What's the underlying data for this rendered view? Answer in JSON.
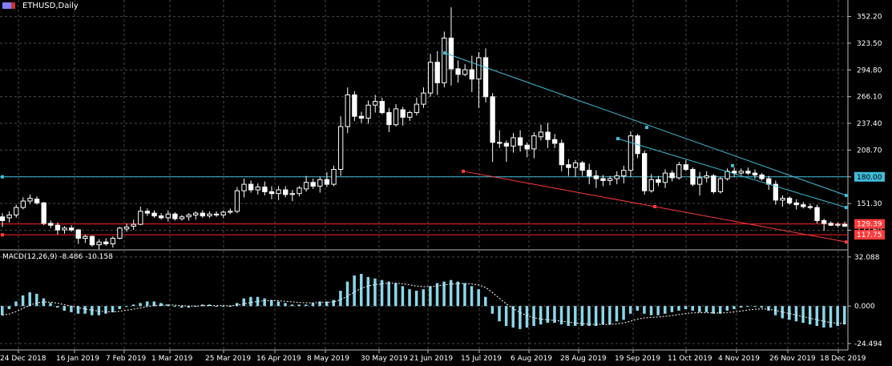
{
  "header": {
    "symbol": "ETHUSD,Daily"
  },
  "macd_header": {
    "name": "MACD(12,26,9)",
    "main": "-8.486",
    "signal": "-10.158"
  },
  "colors": {
    "background": "#000000",
    "grid": "#4a4a4a",
    "candle": "#ffffff",
    "cyan_line": "#3fbcd8",
    "red_line": "#ff3b3b",
    "macd_hist": "#8ad6e8",
    "macd_signal": "#ffffff"
  },
  "chart_data": [
    {
      "type": "candlestick",
      "title": "ETHUSD,Daily",
      "y_ticks": [
        "352.20",
        "323.50",
        "294.80",
        "266.10",
        "237.40",
        "208.70",
        "180.00",
        "151.30",
        "122.60"
      ],
      "ylim": [
        102.4,
        361.3
      ],
      "x_ticks": [
        "24 Dec 2018",
        "16 Jan 2019",
        "7 Feb 2019",
        "1 Mar 2019",
        "25 Mar 2019",
        "16 Apr 2019",
        "8 May 2019",
        "30 May 2019",
        "21 Jun 2019",
        "15 Jul 2019",
        "6 Aug 2019",
        "28 Aug 2019",
        "19 Sep 2019",
        "11 Oct 2019",
        "4 Nov 2019",
        "26 Nov 2019",
        "18 Dec 2019"
      ],
      "grid": true,
      "price_levels": [
        {
          "label": "180.00",
          "value": 180.0,
          "color": "#3fbcd8"
        },
        {
          "label": "129.39",
          "value": 129.39,
          "color": "#ff2020"
        },
        {
          "label": "117.75",
          "value": 117.75,
          "color": "#ff2020"
        }
      ],
      "series": [
        {
          "values": [
            [
              137,
              126,
              141,
              133
            ],
            [
              136,
              131,
              143,
              139
            ],
            [
              139,
              136,
              150,
              147
            ],
            [
              147,
              145,
              158,
              154
            ],
            [
              154,
              151,
              161,
              157
            ],
            [
              156,
              150,
              159,
              152
            ],
            [
              152,
              128,
              153,
              130
            ],
            [
              130,
              125,
              133,
              128
            ],
            [
              128,
              118,
              131,
              123
            ],
            [
              123,
              119,
              127,
              125
            ],
            [
              125,
              121,
              128,
              123
            ],
            [
              123,
              108,
              124,
              114
            ],
            [
              114,
              109,
              118,
              116
            ],
            [
              116,
              105,
              117,
              107
            ],
            [
              107,
              102,
              113,
              110
            ],
            [
              110,
              106,
              114,
              108
            ],
            [
              108,
              104,
              116,
              114
            ],
            [
              114,
              113,
              126,
              125
            ],
            [
              124,
              121,
              130,
              126
            ],
            [
              127,
              123,
              134,
              129
            ],
            [
              129,
              128,
              148,
              143
            ],
            [
              143,
              138,
              146,
              141
            ],
            [
              141,
              136,
              144,
              138
            ],
            [
              138,
              134,
              141,
              136
            ],
            [
              136,
              132,
              144,
              140
            ],
            [
              140,
              133,
              142,
              135
            ],
            [
              135,
              133,
              139,
              137
            ],
            [
              137,
              133,
              141,
              139
            ],
            [
              139,
              134,
              143,
              141
            ],
            [
              141,
              136,
              144,
              138
            ],
            [
              138,
              136,
              143,
              140
            ],
            [
              140,
              137,
              143,
              139
            ],
            [
              139,
              136,
              144,
              142
            ],
            [
              142,
              140,
              146,
              143
            ],
            [
              143,
              141,
              169,
              165
            ],
            [
              165,
              158,
              178,
              172
            ],
            [
              172,
              163,
              176,
              166
            ],
            [
              166,
              161,
              173,
              169
            ],
            [
              169,
              160,
              175,
              164
            ],
            [
              164,
              156,
              170,
              162
            ],
            [
              162,
              155,
              170,
              166
            ],
            [
              166,
              158,
              170,
              161
            ],
            [
              161,
              154,
              166,
              162
            ],
            [
              162,
              159,
              170,
              168
            ],
            [
              167,
              164,
              181,
              174
            ],
            [
              174,
              167,
              178,
              170
            ],
            [
              170,
              163,
              180,
              177
            ],
            [
              177,
              169,
              185,
              172
            ],
            [
              172,
              170,
              192,
              188
            ],
            [
              188,
              181,
              245,
              234
            ],
            [
              234,
              227,
              276,
              268
            ],
            [
              268,
              240,
              272,
              245
            ],
            [
              245,
              238,
              250,
              243
            ],
            [
              243,
              237,
              262,
              257
            ],
            [
              257,
              249,
              268,
              261
            ],
            [
              261,
              247,
              265,
              249
            ],
            [
              249,
              228,
              254,
              236
            ],
            [
              236,
              234,
              258,
              253
            ],
            [
              252,
              235,
              255,
              244
            ],
            [
              244,
              240,
              251,
              249
            ],
            [
              249,
              246,
              265,
              258
            ],
            [
              258,
              254,
              276,
              270
            ],
            [
              270,
              266,
              312,
              303
            ],
            [
              303,
              268,
              315,
              281
            ],
            [
              281,
              276,
              336,
              329
            ],
            [
              329,
              278,
              362,
              296
            ],
            [
              296,
              281,
              305,
              290
            ],
            [
              290,
              288,
              301,
              295
            ],
            [
              295,
              271,
              310,
              285
            ],
            [
              285,
              254,
              314,
              308
            ],
            [
              308,
              260,
              318,
              266
            ],
            [
              266,
              196,
              270,
              217
            ],
            [
              217,
              211,
              230,
              216
            ],
            [
              216,
              196,
              219,
              213
            ],
            [
              213,
              206,
              227,
              222
            ],
            [
              222,
              207,
              230,
              214
            ],
            [
              214,
              201,
              217,
              210
            ],
            [
              210,
              200,
              228,
              224
            ],
            [
              223,
              219,
              236,
              228
            ],
            [
              228,
              211,
              238,
              220
            ],
            [
              220,
              211,
              226,
              216
            ],
            [
              216,
              186,
              220,
              193
            ],
            [
              193,
              181,
              199,
              190
            ],
            [
              190,
              180,
              198,
              195
            ],
            [
              195,
              181,
              197,
              187
            ],
            [
              187,
              172,
              194,
              181
            ],
            [
              181,
              168,
              187,
              178
            ],
            [
              178,
              170,
              182,
              176
            ],
            [
              176,
              171,
              181,
              178
            ],
            [
              178,
              172,
              186,
              181
            ],
            [
              181,
              173,
              192,
              187
            ],
            [
              187,
              180,
              229,
              224
            ],
            [
              224,
              200,
              226,
              205
            ],
            [
              205,
              161,
              208,
              165
            ],
            [
              165,
              163,
              183,
              177
            ],
            [
              177,
              170,
              181,
              174
            ],
            [
              174,
              168,
              188,
              184
            ],
            [
              184,
              175,
              187,
              179
            ],
            [
              179,
              177,
              196,
              193
            ],
            [
              193,
              186,
              198,
              188
            ],
            [
              188,
              170,
              190,
              172
            ],
            [
              172,
              160,
              185,
              179
            ],
            [
              179,
              174,
              186,
              181
            ],
            [
              181,
              162,
              183,
              164
            ],
            [
              164,
              162,
              180,
              178
            ],
            [
              178,
              176,
              189,
              186
            ],
            [
              186,
              180,
              190,
              184
            ],
            [
              184,
              182,
              189,
              186
            ],
            [
              186,
              182,
              190,
              184
            ],
            [
              184,
              178,
              188,
              182
            ],
            [
              182,
              176,
              184,
              178
            ],
            [
              178,
              166,
              181,
              172
            ],
            [
              172,
              150,
              176,
              155
            ],
            [
              155,
              148,
              160,
              157
            ],
            [
              157,
              150,
              159,
              152
            ],
            [
              152,
              145,
              156,
              150
            ],
            [
              150,
              146,
              153,
              148
            ],
            [
              148,
              145,
              151,
              147
            ],
            [
              147,
              130,
              150,
              133
            ],
            [
              133,
              122,
              135,
              130
            ],
            [
              130,
              127,
              132,
              128
            ],
            [
              128,
              126,
              131,
              129
            ],
            [
              129,
              126,
              132,
              127
            ]
          ]
        }
      ]
    },
    {
      "type": "bar",
      "title": "MACD(12,26,9)",
      "y_ticks": [
        "32.088",
        "0.000",
        "-24.494"
      ],
      "ylim": [
        -28.7,
        36.2
      ],
      "series": [
        {
          "name": "-8.486",
          "values": [
            -6,
            -2,
            3,
            7,
            9,
            8,
            5,
            2,
            -1,
            -3,
            -4,
            -5,
            -5,
            -6,
            -6,
            -5,
            -4,
            -2,
            0,
            1,
            2,
            3,
            3,
            2,
            1,
            0,
            -1,
            -1,
            0,
            1,
            1,
            0,
            0,
            0,
            2,
            5,
            6,
            6,
            5,
            4,
            3,
            2,
            1,
            1,
            1,
            2,
            3,
            3,
            4,
            10,
            16,
            20,
            21,
            19,
            18,
            17,
            16,
            15,
            13,
            11,
            10,
            11,
            13,
            15,
            16,
            17,
            16,
            15,
            13,
            11,
            6,
            -5,
            -10,
            -13,
            -14,
            -15,
            -14,
            -13,
            -12,
            -11,
            -11,
            -12,
            -13,
            -13,
            -13,
            -13,
            -13,
            -12,
            -12,
            -10,
            -9,
            -5,
            -3,
            -5,
            -6,
            -6,
            -5,
            -4,
            -3,
            -2,
            -3,
            -4,
            -4,
            -5,
            -5,
            -3,
            -2,
            -1,
            0,
            0,
            -1,
            -3,
            -6,
            -8,
            -9,
            -10,
            -11,
            -12,
            -13,
            -14,
            -14,
            -13,
            -12
          ]
        }
      ]
    }
  ]
}
